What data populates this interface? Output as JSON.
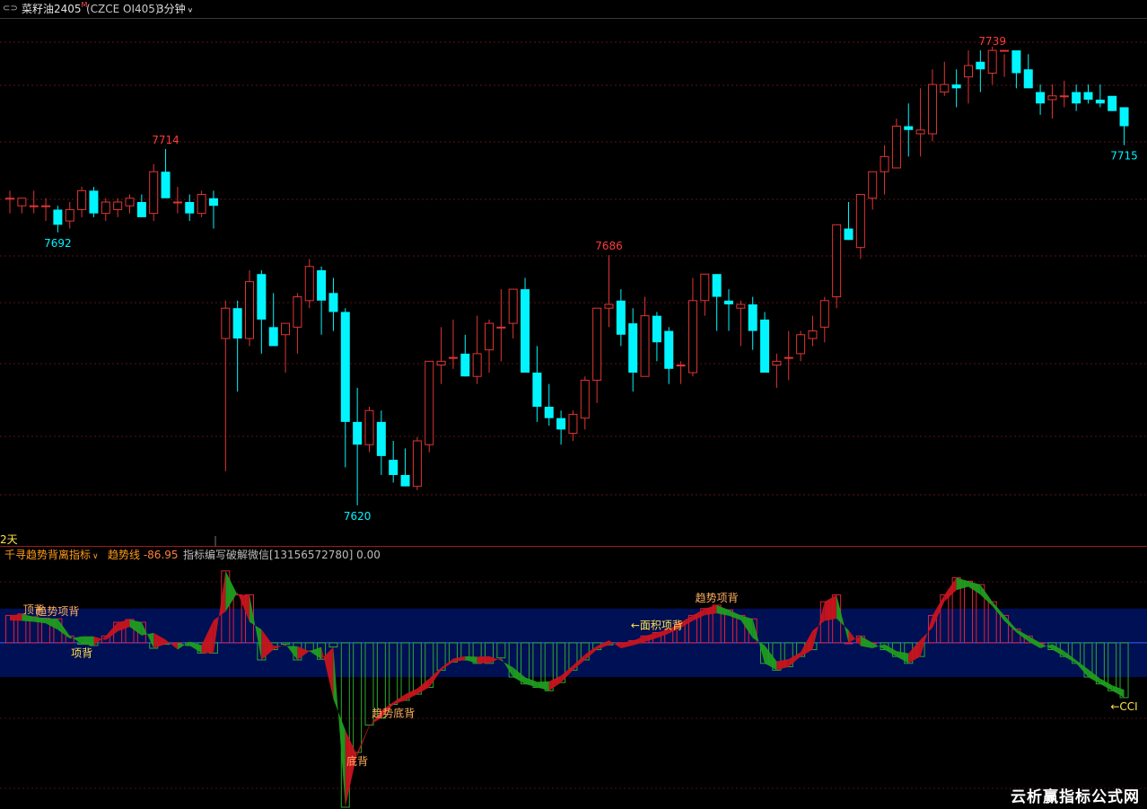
{
  "header": {
    "link_icon": "link-icon",
    "instrument_name": "菜籽油2405",
    "superscript": "M",
    "instrument_code": "(CZCE OI405)",
    "period": "3分钟",
    "period_icon": "chevron-down-icon"
  },
  "side_tag": "2天",
  "indicator_bar": {
    "name": "千寻趋势背离指标",
    "name_icon": "chevron-down-icon",
    "line_label": "趋势线",
    "line_value": "-86.95",
    "note": "指标编写破解微信[13156572780] 0.00"
  },
  "watermark": "云析赢指标公式网",
  "colors": {
    "up": "#ff3b3b",
    "down": "#00f5ff",
    "up_bar": "#e0203a",
    "down_bar": "#2ea82e",
    "band": "#001055",
    "label_yellow": "#ffe34a",
    "label_orange": "#ffb060"
  },
  "chart_data": [
    {
      "type": "candlestick",
      "yrange": [
        7610,
        7745
      ],
      "candles": [
        [
          7701,
          7703,
          7697,
          7701
        ],
        [
          7699,
          7701,
          7697,
          7701
        ],
        [
          7699,
          7703,
          7697,
          7699
        ],
        [
          7699,
          7701,
          7695,
          7699
        ],
        [
          7698,
          7699,
          7692,
          7694
        ],
        [
          7695,
          7700,
          7693,
          7698
        ],
        [
          7698,
          7704,
          7696,
          7703
        ],
        [
          7703,
          7704,
          7696,
          7697
        ],
        [
          7697,
          7701,
          7695,
          7700
        ],
        [
          7698,
          7701,
          7696,
          7700
        ],
        [
          7699,
          7702,
          7697,
          7701
        ],
        [
          7700,
          7702,
          7696,
          7696
        ],
        [
          7697,
          7710,
          7695,
          7708
        ],
        [
          7708,
          7714,
          7702,
          7701
        ],
        [
          7700,
          7704,
          7697,
          7700
        ],
        [
          7700,
          7702,
          7695,
          7697
        ],
        [
          7697,
          7703,
          7696,
          7702
        ],
        [
          7701,
          7703,
          7693,
          7699
        ],
        [
          7664,
          7674,
          7629,
          7672
        ],
        [
          7672,
          7674,
          7650,
          7664
        ],
        [
          7664,
          7682,
          7662,
          7679
        ],
        [
          7681,
          7682,
          7660,
          7669
        ],
        [
          7667,
          7676,
          7662,
          7662
        ],
        [
          7665,
          7668,
          7655,
          7668
        ],
        [
          7667,
          7676,
          7660,
          7675
        ],
        [
          7674,
          7685,
          7672,
          7683
        ],
        [
          7682,
          7683,
          7665,
          7674
        ],
        [
          7676,
          7680,
          7666,
          7671
        ],
        [
          7671,
          7672,
          7630,
          7642
        ],
        [
          7642,
          7651,
          7620,
          7636
        ],
        [
          7636,
          7646,
          7634,
          7645
        ],
        [
          7642,
          7645,
          7628,
          7633
        ],
        [
          7632,
          7637,
          7626,
          7628
        ],
        [
          7628,
          7635,
          7625,
          7625
        ],
        [
          7625,
          7638,
          7624,
          7637
        ],
        [
          7636,
          7658,
          7634,
          7658
        ],
        [
          7657,
          7667,
          7652,
          7658
        ],
        [
          7659,
          7669,
          7656,
          7659
        ],
        [
          7660,
          7665,
          7654,
          7654
        ],
        [
          7654,
          7670,
          7652,
          7660
        ],
        [
          7661,
          7669,
          7655,
          7668
        ],
        [
          7667,
          7677,
          7658,
          7667
        ],
        [
          7668,
          7677,
          7664,
          7677
        ],
        [
          7677,
          7680,
          7655,
          7655
        ],
        [
          7655,
          7662,
          7642,
          7646
        ],
        [
          7646,
          7652,
          7641,
          7643
        ],
        [
          7643,
          7645,
          7636,
          7640
        ],
        [
          7639,
          7645,
          7637,
          7644
        ],
        [
          7643,
          7654,
          7640,
          7653
        ],
        [
          7653,
          7672,
          7647,
          7672
        ],
        [
          7672,
          7686,
          7667,
          7673
        ],
        [
          7674,
          7677,
          7662,
          7665
        ],
        [
          7668,
          7672,
          7650,
          7655
        ],
        [
          7654,
          7675,
          7655,
          7670
        ],
        [
          7670,
          7671,
          7658,
          7663
        ],
        [
          7666,
          7667,
          7652,
          7656
        ],
        [
          7657,
          7658,
          7652,
          7657
        ],
        [
          7655,
          7680,
          7654,
          7674
        ],
        [
          7674,
          7680,
          7670,
          7681
        ],
        [
          7681,
          7681,
          7666,
          7675
        ],
        [
          7674,
          7677,
          7666,
          7673
        ],
        [
          7672,
          7674,
          7662,
          7673
        ],
        [
          7673,
          7675,
          7661,
          7666
        ],
        [
          7669,
          7671,
          7656,
          7655
        ],
        [
          7657,
          7660,
          7651,
          7658
        ],
        [
          7659,
          7666,
          7653,
          7659
        ],
        [
          7660,
          7666,
          7658,
          7665
        ],
        [
          7664,
          7670,
          7662,
          7666
        ],
        [
          7667,
          7675,
          7663,
          7674
        ],
        [
          7675,
          7691,
          7672,
          7694
        ],
        [
          7693,
          7700,
          7690,
          7690
        ],
        [
          7688,
          7701,
          7685,
          7702
        ],
        [
          7701,
          7707,
          7698,
          7708
        ],
        [
          7708,
          7715,
          7702,
          7712
        ],
        [
          7709,
          7722,
          7709,
          7720
        ],
        [
          7720,
          7726,
          7712,
          7719
        ],
        [
          7718,
          7730,
          7712,
          7719
        ],
        [
          7718,
          7735,
          7716,
          7731
        ],
        [
          7729,
          7737,
          7728,
          7731
        ],
        [
          7731,
          7735,
          7725,
          7730
        ],
        [
          7733,
          7740,
          7726,
          7736
        ],
        [
          7737,
          7740,
          7729,
          7735
        ],
        [
          7734,
          7741,
          7731,
          7740
        ],
        [
          7740,
          7739,
          7733,
          7740
        ],
        [
          7740,
          7739,
          7730,
          7734
        ],
        [
          7735,
          7739,
          7732,
          7730
        ],
        [
          7729,
          7731,
          7723,
          7726
        ],
        [
          7727,
          7731,
          7722,
          7728
        ],
        [
          7728,
          7732,
          7725,
          7728
        ],
        [
          7729,
          7731,
          7724,
          7726
        ],
        [
          7729,
          7731,
          7726,
          7727
        ],
        [
          7727,
          7731,
          7725,
          7726
        ],
        [
          7728,
          7727,
          7724,
          7724
        ],
        [
          7725,
          7724,
          7715,
          7720
        ]
      ],
      "annotations": [
        {
          "label": "7714",
          "index": 13,
          "value": 7714,
          "pos": "above",
          "color": "up"
        },
        {
          "label": "7692",
          "index": 4,
          "value": 7692,
          "pos": "below",
          "color": "down"
        },
        {
          "label": "7620",
          "index": 29,
          "value": 7620,
          "pos": "below",
          "color": "down"
        },
        {
          "label": "7686",
          "index": 50,
          "value": 7686,
          "pos": "above",
          "color": "up"
        },
        {
          "label": "7739",
          "index": 82,
          "value": 7740,
          "pos": "above",
          "color": "up"
        },
        {
          "label": "7715",
          "index": 93,
          "value": 7715,
          "pos": "below",
          "color": "down"
        }
      ]
    },
    {
      "type": "indicator_bar",
      "yrange": [
        -240,
        110
      ],
      "band": [
        -50,
        50
      ],
      "zero_line": true,
      "values": [
        40,
        42,
        38,
        36,
        35,
        10,
        -2,
        -4,
        10,
        30,
        34,
        30,
        -8,
        -2,
        0,
        -4,
        -15,
        -15,
        105,
        70,
        70,
        -25,
        -10,
        -2,
        -25,
        -12,
        -24,
        -6,
        -240,
        -160,
        -120,
        -110,
        -90,
        -84,
        -75,
        -65,
        -40,
        -28,
        -25,
        -30,
        -30,
        -22,
        -50,
        -60,
        -65,
        -70,
        -58,
        -40,
        -25,
        -10,
        -3,
        0,
        3,
        10,
        15,
        20,
        30,
        40,
        50,
        55,
        48,
        40,
        35,
        -30,
        -40,
        -35,
        -20,
        -10,
        60,
        70,
        0,
        10,
        0,
        -10,
        -20,
        -30,
        -20,
        40,
        70,
        95,
        90,
        85,
        60,
        40,
        20,
        10,
        0,
        -10,
        -20,
        -30,
        -50,
        -60,
        -70,
        -80
      ],
      "annotations": [
        {
          "label": "顶背",
          "index": 2,
          "color": "label_orange"
        },
        {
          "label": "趋势项背",
          "index": 4,
          "color": "label_orange"
        },
        {
          "label": "项背",
          "index": 6,
          "color": "label_yellow"
        },
        {
          "label": "底背",
          "index": 29,
          "color": "label_orange"
        },
        {
          "label": "趋势底背",
          "index": 32,
          "color": "label_orange"
        },
        {
          "label": "←面积项背",
          "index": 54,
          "color": "label_yellow"
        },
        {
          "label": "趋势项背",
          "index": 59,
          "color": "label_orange"
        },
        {
          "label": "←CCI",
          "index": 93,
          "color": "label_yellow"
        }
      ]
    }
  ]
}
